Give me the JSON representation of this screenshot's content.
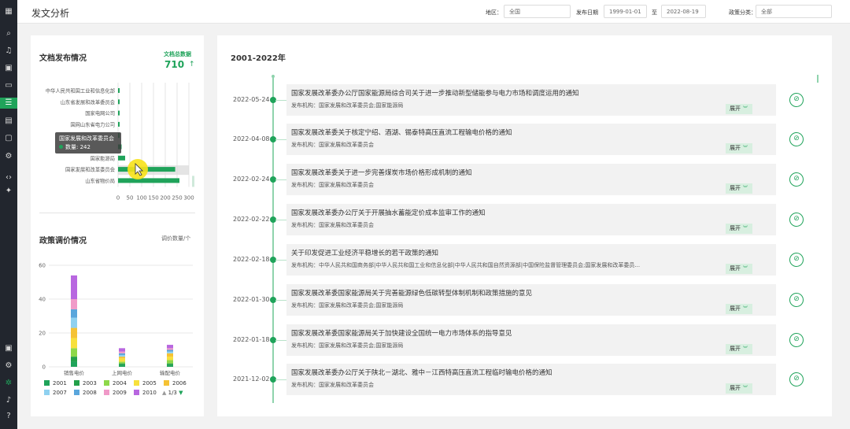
{
  "header": {
    "title": "发文分析",
    "region_label": "地区：",
    "region_value": "全国",
    "date_label": "发布日期",
    "date_start": "1999-01-01",
    "date_sep": "至",
    "date_end": "2022-08-19",
    "category_label": "政策分类：",
    "category_value": "全部"
  },
  "rail_icons": [
    "grid-icon",
    "search-icon",
    "music-icon",
    "image-search-icon",
    "folder-icon",
    "list-icon",
    "picture-icon",
    "window-icon",
    "gear-icon",
    "code-icon",
    "pin-icon",
    "gallery-icon",
    "settings-icon",
    "green-gear-icon",
    "bell-icon",
    "help-icon"
  ],
  "doc_release": {
    "title": "文档发布情况",
    "total_label": "文档总数据",
    "total_value": "710",
    "total_arrow": "↑",
    "tooltip": {
      "title": "国家发展和改革委员会",
      "label": "数量: 242"
    }
  },
  "price_policy": {
    "title": "政策调价情况",
    "unit": "调价数量/个",
    "pager": "1/3"
  },
  "chart_data": [
    {
      "type": "bar",
      "orientation": "horizontal",
      "categories": [
        "中华人民共和国工业和信息化部",
        "山东省发展和改革委员会",
        "国家电网公司",
        "国网山东省电力公司",
        "国家发展改革委",
        "国家发展和改革委员会能源局",
        "国家能源局",
        "国家发展和改革委员会",
        "山东省物价局"
      ],
      "visible_category_labels": [
        "中华人民共和国工业和信息化部",
        "山东省发展和改革委员会",
        "国家电网公司",
        "国网山东省电力公司",
        "国家能源局",
        "国家发展和改革委员会",
        "山东省物价局"
      ],
      "values": [
        5,
        5,
        5,
        5,
        4,
        15,
        30,
        242,
        260
      ],
      "xlim": [
        0,
        300
      ],
      "xticks": [
        0,
        50,
        100,
        150,
        200,
        250,
        300
      ],
      "grid": true,
      "color": "#1fa35a"
    },
    {
      "type": "bar",
      "stacked": true,
      "categories": [
        "销售电价",
        "上网电价",
        "输配电价"
      ],
      "ylim": [
        0,
        60
      ],
      "yticks": [
        0,
        20,
        40,
        60
      ],
      "series": [
        {
          "name": "2001",
          "color": "#1fa35a",
          "values": [
            3,
            1,
            1
          ]
        },
        {
          "name": "2003",
          "color": "#23a04a",
          "values": [
            3,
            1,
            1
          ]
        },
        {
          "name": "2004",
          "color": "#8ed84a",
          "values": [
            5,
            1,
            2
          ]
        },
        {
          "name": "2005",
          "color": "#f7e03c",
          "values": [
            6,
            2,
            2
          ]
        },
        {
          "name": "2006",
          "color": "#f5c234",
          "values": [
            6,
            1,
            2
          ]
        },
        {
          "name": "2007",
          "color": "#8fd1f0",
          "values": [
            6,
            1,
            1
          ]
        },
        {
          "name": "2008",
          "color": "#5aa6dc",
          "values": [
            5,
            1,
            1
          ]
        },
        {
          "name": "2009",
          "color": "#f09ac8",
          "values": [
            6,
            1,
            1
          ]
        },
        {
          "name": "2010",
          "color": "#b867e0",
          "values": [
            14,
            2,
            2
          ]
        }
      ],
      "legend_position": "bottom"
    }
  ],
  "timeline": {
    "year": "2001-2022年",
    "publisher_prefix": "发布机构：",
    "expand_label": "展开",
    "items": [
      {
        "date": "2022-05-24",
        "title": "国家发展改革委办公厅国家能源局综合司关于进一步推动新型储能参与电力市场和调度运用的通知",
        "publisher": "国家发展和改革委员会;国家能源局"
      },
      {
        "date": "2022-04-08",
        "title": "国家发展改革委关于核定宁绍、酒湖、锡泰特高压直流工程输电价格的通知",
        "publisher": "国家发展和改革委员会"
      },
      {
        "date": "2022-02-24",
        "title": "国家发展改革委关于进一步完善煤炭市场价格形成机制的通知",
        "publisher": "国家发展和改革委员会"
      },
      {
        "date": "2022-02-22",
        "title": "国家发展改革委办公厅关于开展抽水蓄能定价成本监审工作的通知",
        "publisher": "国家发展和改革委员会"
      },
      {
        "date": "2022-02-18",
        "title": "关于印发促进工业经济平稳增长的若干政策的通知",
        "publisher": "中华人民共和国商务部|中华人民共和国工业和信息化部|中华人民共和国自然资源部|中国保险监督管理委员会;国家发展和改革委员..."
      },
      {
        "date": "2022-01-30",
        "title": "国家发展改革委国家能源局关于完善能源绿色低碳转型体制机制和政策措施的意见",
        "publisher": "国家发展和改革委员会;国家能源局"
      },
      {
        "date": "2022-01-18",
        "title": "国家发展改革委国家能源局关于加快建设全国统一电力市场体系的指导意见",
        "publisher": "国家发展和改革委员会;国家能源局"
      },
      {
        "date": "2021-12-02",
        "title": "国家发展改革委办公厅关于陕北－湖北、雅中－江西特高压直流工程临时输电价格的通知",
        "publisher": "国家发展和改革委员会"
      }
    ]
  }
}
